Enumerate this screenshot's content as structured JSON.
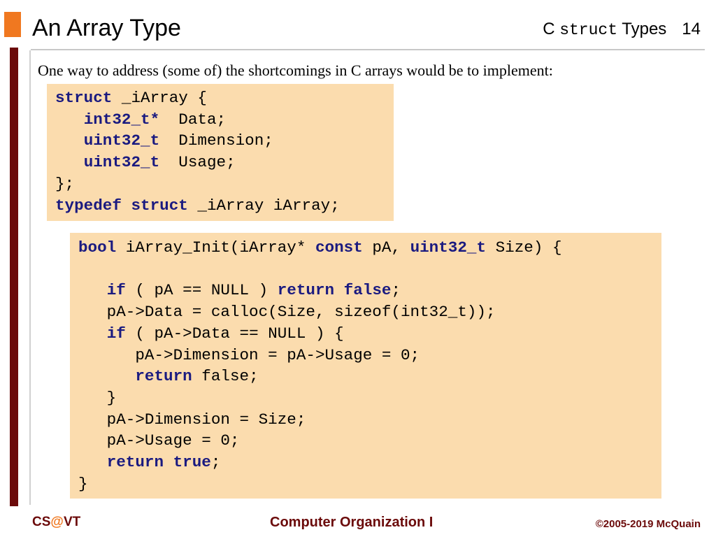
{
  "header": {
    "title": "An Array Type",
    "topic_prefix": "C ",
    "topic_mono": "struct",
    "topic_suffix": " Types",
    "page_number": "14"
  },
  "intro_text": "One way to address (some of) the shortcomings in C arrays would be to implement:",
  "code_block_1": [
    [
      "struct",
      " _iArray {"
    ],
    [
      "",
      "   "
    ],
    [
      "",
      "};"
    ],
    [
      "typedef struct",
      " _iArray iArray;"
    ]
  ],
  "code1": {
    "l1_kw": "struct",
    "l1_rest": " _iArray {",
    "l2_indent": "   ",
    "l2_kw": "int32_t*",
    "l2_rest": "  Data;",
    "l3_indent": "   ",
    "l3_kw": "uint32_t",
    "l3_rest": "  Dimension;",
    "l4_indent": "   ",
    "l4_kw": "uint32_t",
    "l4_rest": "  Usage;",
    "l5_rest": "};",
    "l6_kw": "typedef struct",
    "l6_rest": " _iArray iArray;"
  },
  "code2": {
    "l1_kw1": "bool",
    "l1_a": " iArray_Init(iArray* ",
    "l1_kw2": "const",
    "l1_b": " pA, ",
    "l1_kw3": "uint32_t",
    "l1_c": " Size) {",
    "l3_indent": "   ",
    "l3_kw1": "if",
    "l3_a": " ( pA == NULL ) ",
    "l3_kw2": "return false",
    "l3_b": ";",
    "l4": "   pA->Data = calloc(Size, sizeof(int32_t));",
    "l5_indent": "   ",
    "l5_kw": "if",
    "l5_a": " ( pA->Data == NULL ) {",
    "l6": "      pA->Dimension = pA->Usage = 0;",
    "l7_indent": "      ",
    "l7_kw": "return",
    "l7_a": " false;",
    "l8": "   }",
    "l9": "   pA->Dimension = Size;",
    "l10": "   pA->Usage = 0;",
    "l11_indent": "   ",
    "l11_kw": "return true",
    "l11_a": ";",
    "l12": "}"
  },
  "footer": {
    "left_cs": "CS",
    "left_at": "@",
    "left_vt": "VT",
    "center": "Computer Organization I",
    "right": "©2005-2019 McQuain"
  },
  "colors": {
    "accent_orange": "#f07820",
    "dark_red": "#6b0a0a",
    "code_background": "#fbdcae",
    "keyword": "#1a1a80"
  }
}
